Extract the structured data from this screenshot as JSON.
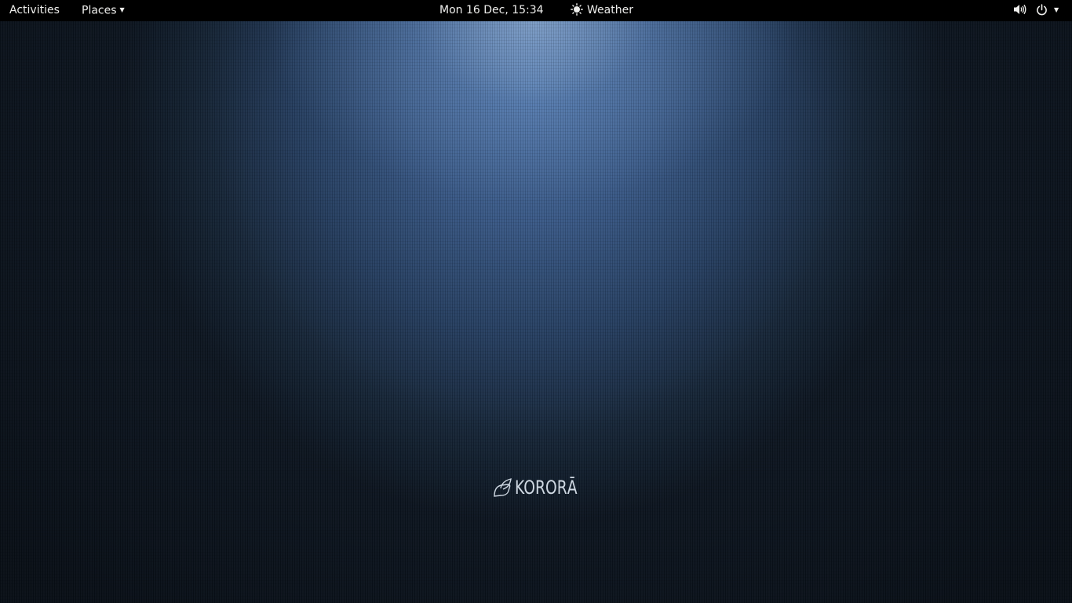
{
  "top_bar": {
    "activities_label": "Activities",
    "places_label": "Places",
    "clock_text": "Mon 16 Dec, 15:34",
    "weather_label": "Weather",
    "weather_icon": "sun-icon",
    "volume_icon": "volume-icon",
    "power_icon": "power-icon"
  },
  "desktop": {
    "logo_text": "KORORĀ",
    "logo_icon": "korora-leaf-icon"
  },
  "colors": {
    "panel_background": "#000000",
    "panel_text": "#eeeeec",
    "wallpaper_highlight": "#4d72a6",
    "wallpaper_dark": "#0d1723"
  }
}
